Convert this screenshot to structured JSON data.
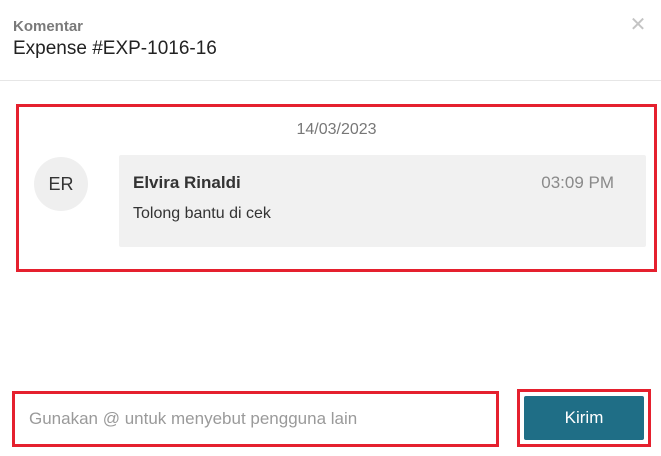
{
  "header": {
    "label": "Komentar",
    "title": "Expense #EXP-1016-16",
    "close_icon": "close-icon"
  },
  "thread": {
    "date": "14/03/2023",
    "comments": [
      {
        "avatar_initials": "ER",
        "author": "Elvira Rinaldi",
        "time": "03:09 PM",
        "text": "Tolong bantu di cek"
      }
    ]
  },
  "composer": {
    "placeholder": "Gunakan @ untuk menyebut pengguna lain",
    "value": "",
    "send_label": "Kirim"
  },
  "colors": {
    "accent": "#1f6e86",
    "highlight": "#e5202e",
    "bubble_bg": "#f1f1f1"
  }
}
